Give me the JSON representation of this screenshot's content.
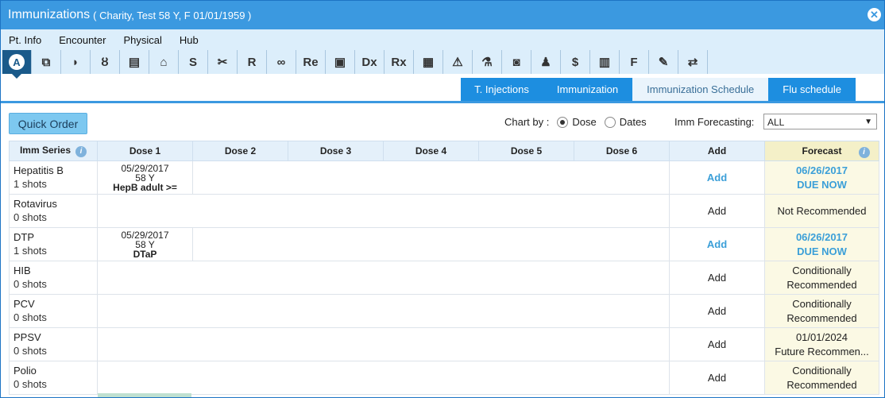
{
  "window": {
    "title": "Immunizations",
    "patient": "( Charity, Test   58 Y,   F   01/01/1959 )"
  },
  "menu": [
    "Pt. Info",
    "Encounter",
    "Physical",
    "Hub"
  ],
  "icons": [
    {
      "name": "a-circle-icon",
      "glyph": "A"
    },
    {
      "name": "copy-documents-icon",
      "glyph": "⧉"
    },
    {
      "name": "pill-icon",
      "glyph": "◗"
    },
    {
      "name": "stethoscope-icon",
      "glyph": "ȣ"
    },
    {
      "name": "chart-note-icon",
      "glyph": "▤"
    },
    {
      "name": "family-icon",
      "glyph": "⌂"
    },
    {
      "name": "s-icon",
      "glyph": "S"
    },
    {
      "name": "scissors-icon",
      "glyph": "✂"
    },
    {
      "name": "r-icon",
      "glyph": "R"
    },
    {
      "name": "glasses-icon",
      "glyph": "∞"
    },
    {
      "name": "re-icon",
      "glyph": "Re"
    },
    {
      "name": "bottle-icon",
      "glyph": "▣"
    },
    {
      "name": "dx-icon",
      "glyph": "Dx"
    },
    {
      "name": "rx-icon",
      "glyph": "Rx"
    },
    {
      "name": "calculator-icon",
      "glyph": "▦"
    },
    {
      "name": "clipboard-warning-icon",
      "glyph": "⚠"
    },
    {
      "name": "lab-flask-icon",
      "glyph": "⚗"
    },
    {
      "name": "xray-icon",
      "glyph": "◙"
    },
    {
      "name": "bell-icon",
      "glyph": "♟"
    },
    {
      "name": "billing-icon",
      "glyph": "$"
    },
    {
      "name": "ledger-icon",
      "glyph": "▥"
    },
    {
      "name": "fs-icon",
      "glyph": "F"
    },
    {
      "name": "syringe-icon",
      "glyph": "✎"
    },
    {
      "name": "transfer-icon",
      "glyph": "⇄"
    }
  ],
  "tabs": [
    "T. Injections",
    "Immunization",
    "Immunization Schedule",
    "Flu schedule"
  ],
  "selected_tab": 2,
  "toolbar": {
    "quick_order": "Quick Order",
    "chart_by_label": "Chart by :",
    "dose_label": "Dose",
    "dates_label": "Dates",
    "forecasting_label": "Imm Forecasting:",
    "forecasting_value": "ALL"
  },
  "table": {
    "headers": {
      "series": "Imm Series",
      "dose1": "Dose 1",
      "dose2": "Dose 2",
      "dose3": "Dose 3",
      "dose4": "Dose 4",
      "dose5": "Dose 5",
      "dose6": "Dose 6",
      "add": "Add",
      "forecast": "Forecast"
    },
    "rows": [
      {
        "name": "Hepatitis B",
        "shots": "1 shots",
        "dose1": {
          "date": "05/29/2017",
          "age": "58 Y",
          "vaccine": "HepB adult >="
        },
        "add": "Add",
        "add_active": true,
        "forecast1": "06/26/2017",
        "forecast2": "DUE NOW",
        "due": true
      },
      {
        "name": "Rotavirus",
        "shots": "0 shots",
        "dose1": null,
        "add": "Add",
        "add_active": false,
        "forecast1": "Not Recommended",
        "forecast2": "",
        "due": false
      },
      {
        "name": "DTP",
        "shots": "1 shots",
        "dose1": {
          "date": "05/29/2017",
          "age": "58 Y",
          "vaccine": "DTaP"
        },
        "add": "Add",
        "add_active": true,
        "forecast1": "06/26/2017",
        "forecast2": "DUE NOW",
        "due": true
      },
      {
        "name": "HIB",
        "shots": "0 shots",
        "dose1": null,
        "add": "Add",
        "add_active": false,
        "forecast1": "Conditionally",
        "forecast2": "Recommended",
        "due": false
      },
      {
        "name": "PCV",
        "shots": "0 shots",
        "dose1": null,
        "add": "Add",
        "add_active": false,
        "forecast1": "Conditionally",
        "forecast2": "Recommended",
        "due": false
      },
      {
        "name": "PPSV",
        "shots": "0 shots",
        "dose1": null,
        "add": "Add",
        "add_active": false,
        "forecast1": "01/01/2024",
        "forecast2": "Future Recommen...",
        "due": false
      },
      {
        "name": "Polio",
        "shots": "0 shots",
        "dose1": null,
        "add": "Add",
        "add_active": false,
        "forecast1": "Conditionally",
        "forecast2": "Recommended",
        "due": false
      }
    ]
  }
}
